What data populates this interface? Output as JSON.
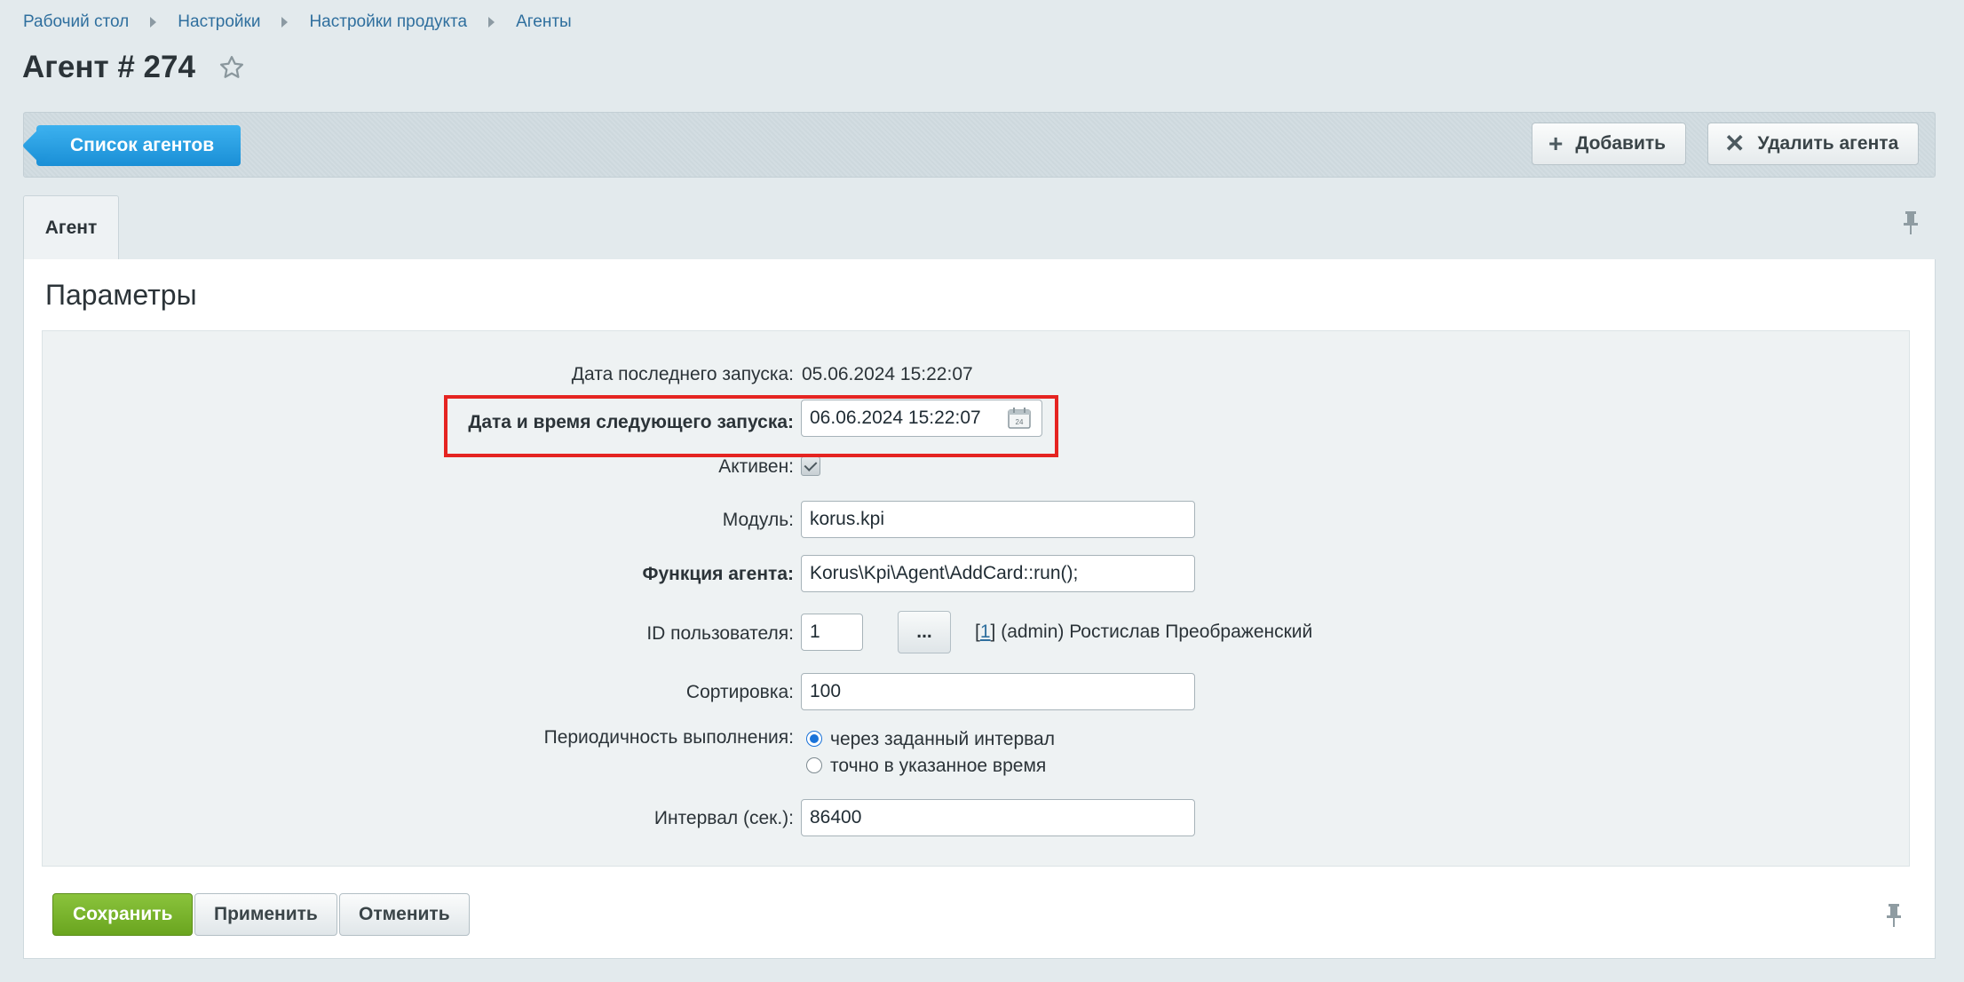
{
  "breadcrumb": [
    "Рабочий стол",
    "Настройки",
    "Настройки продукта",
    "Агенты"
  ],
  "page_title": "Агент # 274",
  "toolbar": {
    "list_label": "Список агентов",
    "add_label": "Добавить",
    "delete_label": "Удалить агента"
  },
  "tabs": [
    {
      "label": "Агент"
    }
  ],
  "section_title": "Параметры",
  "form": {
    "last_run_label": "Дата последнего запуска:",
    "last_run_value": "05.06.2024 15:22:07",
    "next_run_label": "Дата и время следующего запуска:",
    "next_run_value": "06.06.2024 15:22:07",
    "active_label": "Активен:",
    "active_checked": true,
    "module_label": "Модуль:",
    "module_value": "korus.kpi",
    "function_label": "Функция агента:",
    "function_value": "Korus\\Kpi\\Agent\\AddCard::run();",
    "user_id_label": "ID пользователя:",
    "user_id_value": "1",
    "user_picker_label": "...",
    "user_link": "1",
    "user_info_prefix": "[",
    "user_info_suffix": "] (admin) Ростислав Преображенский",
    "sort_label": "Сортировка:",
    "sort_value": "100",
    "periodicity_label": "Периодичность выполнения:",
    "periodicity_options": [
      "через заданный интервал",
      "точно в указанное время"
    ],
    "periodicity_selected": 0,
    "interval_label": "Интервал (сек.):",
    "interval_value": "86400"
  },
  "buttons": {
    "save": "Сохранить",
    "apply": "Применить",
    "cancel": "Отменить"
  },
  "colors": {
    "accent_blue": "#1a8fd6",
    "save_green": "#6aa51f",
    "highlight_red": "#e52421"
  }
}
